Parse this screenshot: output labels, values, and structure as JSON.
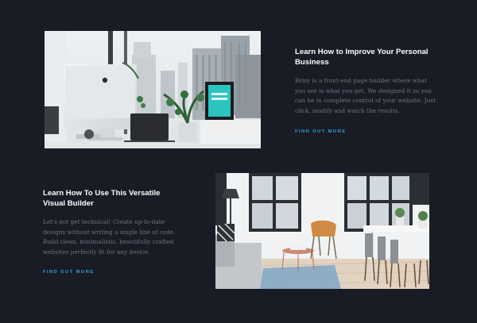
{
  "features": [
    {
      "title": "Learn How to Improve Your Personal Business",
      "description": "Brizy is a front-end page builder where what you see is what you get. We designed it so you can be in complete control of your website. Just click, modify and watch the results.",
      "cta_label": "FIND OUT MORE",
      "image_alt": "Desk with a computer, laptop and plants in front of a city window"
    },
    {
      "title": "Learn How To Use This Versatile Visual Builder",
      "description": "Let's not get technical! Create up-to-date designs without writing a single line of code. Build clean, minimalistic, beautifully crafted websites perfectly fit for any device.",
      "cta_label": "FIND OUT MORE",
      "image_alt": "Bright living room with sofa, orange chair and dining table"
    }
  ],
  "colors": {
    "background": "#191c24",
    "heading": "#ffffff",
    "body": "#6f7380",
    "accent": "#2f9ee0"
  }
}
